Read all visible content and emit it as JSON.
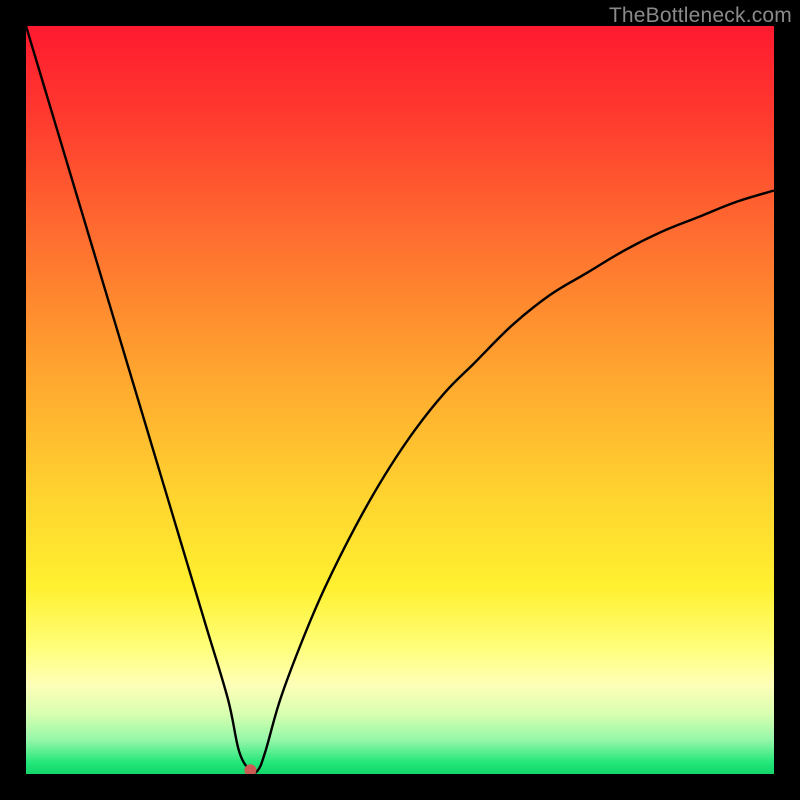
{
  "watermark": "TheBottleneck.com",
  "chart_data": {
    "type": "line",
    "title": "",
    "xlabel": "",
    "ylabel": "",
    "xlim": [
      0,
      100
    ],
    "ylim": [
      0,
      100
    ],
    "grid": false,
    "legend": false,
    "series": [
      {
        "name": "bottleneck-curve",
        "x": [
          0,
          3,
          6,
          9,
          12,
          15,
          18,
          21,
          24,
          27,
          28.5,
          30,
          31,
          32,
          34,
          37,
          40,
          44,
          48,
          52,
          56,
          60,
          65,
          70,
          75,
          80,
          85,
          90,
          95,
          100
        ],
        "y": [
          100,
          90,
          80,
          70,
          60,
          50,
          40,
          30,
          20,
          10,
          3,
          0.5,
          0.5,
          3,
          10,
          18,
          25,
          33,
          40,
          46,
          51,
          55,
          60,
          64,
          67,
          70,
          72.5,
          74.5,
          76.5,
          78
        ],
        "marker_index": 11
      }
    ],
    "gradient_stops": [
      {
        "pos": 0.0,
        "color": "#ff1a2f"
      },
      {
        "pos": 0.12,
        "color": "#ff3a2f"
      },
      {
        "pos": 0.28,
        "color": "#ff6e30"
      },
      {
        "pos": 0.45,
        "color": "#ffa22f"
      },
      {
        "pos": 0.62,
        "color": "#ffd22f"
      },
      {
        "pos": 0.75,
        "color": "#fff130"
      },
      {
        "pos": 0.83,
        "color": "#ffff7a"
      },
      {
        "pos": 0.88,
        "color": "#ffffb8"
      },
      {
        "pos": 0.92,
        "color": "#d8ffb0"
      },
      {
        "pos": 0.955,
        "color": "#94f7a8"
      },
      {
        "pos": 0.985,
        "color": "#23e77a"
      },
      {
        "pos": 1.0,
        "color": "#12d66a"
      }
    ]
  }
}
